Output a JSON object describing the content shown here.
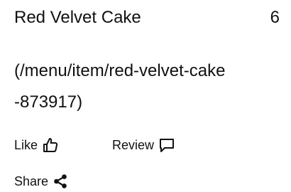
{
  "item": {
    "title": "Red Velvet Cake",
    "price": "6",
    "link_text": "(/menu/item/red-velvet-cake-873917)"
  },
  "actions": {
    "like_label": "Like",
    "like_icon": "thumbs-up-icon",
    "review_label": "Review",
    "review_icon": "comment-icon",
    "share_label": "Share",
    "share_icon": "share-icon"
  }
}
